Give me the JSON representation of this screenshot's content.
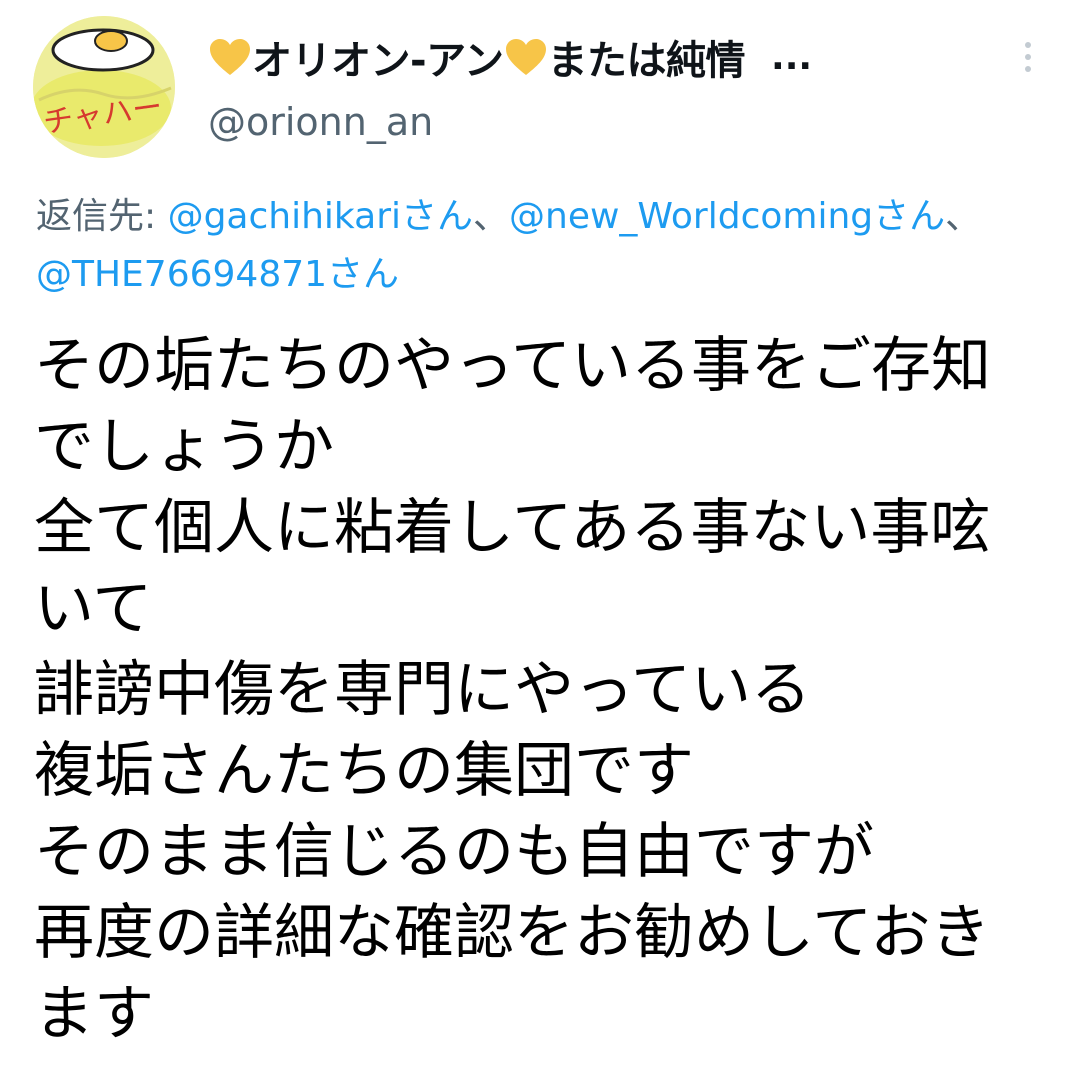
{
  "author": {
    "name": "オリオン-アンまたは純情",
    "name_parts": [
      "オリオン-アン",
      "または純情"
    ],
    "handle": "@orionn_an",
    "avatar_text": "チャハー",
    "more_label": "..."
  },
  "reply": {
    "prefix": "返信先: ",
    "mentions": [
      "@gachihikariさん",
      "@new_Worldcomingさん",
      "@THE76694871さん"
    ],
    "separator": "、"
  },
  "tweet": {
    "lines": [
      "その垢たちのやっている事をご存知",
      "でしょうか",
      "全て個人に粘着してある事ない事呟",
      "いて",
      "誹謗中傷を専門にやっている",
      "複垢さんたちの集団です",
      "そのまま信じるのも自由ですが",
      "再度の詳細な確認をお勧めしておき",
      "ます"
    ]
  },
  "colors": {
    "heart": "#f7c548",
    "link": "#1d9bf0",
    "secondary_text": "#536471"
  },
  "icons": [
    "yellow-heart-icon",
    "more-icon"
  ]
}
